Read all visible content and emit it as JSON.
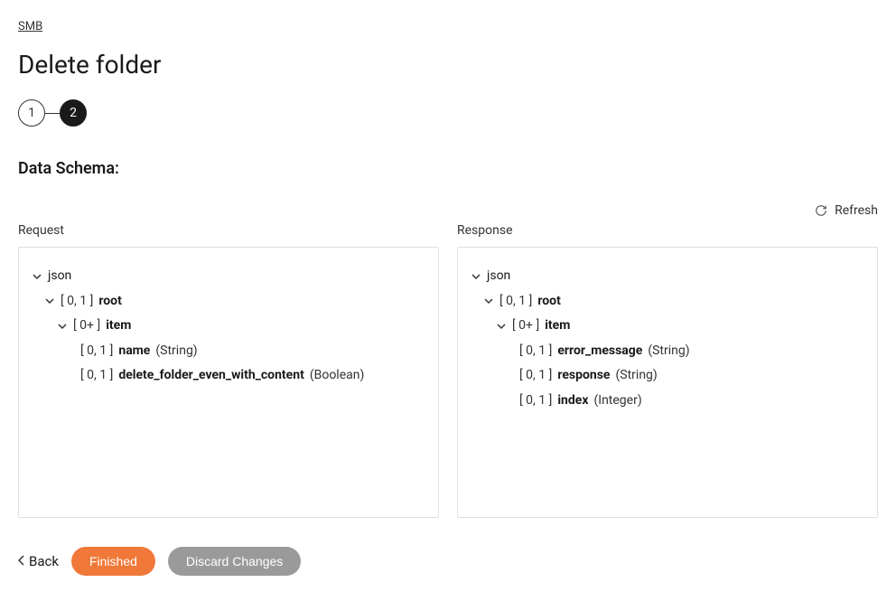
{
  "breadcrumb": "SMB",
  "page_title": "Delete folder",
  "stepper": {
    "step1": "1",
    "step2": "2"
  },
  "section_title": "Data Schema:",
  "refresh_label": "Refresh",
  "columns": {
    "request_label": "Request",
    "response_label": "Response"
  },
  "request_tree": {
    "json": "json",
    "root_card": "[ 0, 1 ]",
    "root_name": "root",
    "item_card": "[ 0+ ]",
    "item_name": "item",
    "f1_card": "[ 0, 1 ]",
    "f1_name": "name",
    "f1_type": "(String)",
    "f2_card": "[ 0, 1 ]",
    "f2_name": "delete_folder_even_with_content",
    "f2_type": "(Boolean)"
  },
  "response_tree": {
    "json": "json",
    "root_card": "[ 0, 1 ]",
    "root_name": "root",
    "item_card": "[ 0+ ]",
    "item_name": "item",
    "f1_card": "[ 0, 1 ]",
    "f1_name": "error_message",
    "f1_type": "(String)",
    "f2_card": "[ 0, 1 ]",
    "f2_name": "response",
    "f2_type": "(String)",
    "f3_card": "[ 0, 1 ]",
    "f3_name": "index",
    "f3_type": "(Integer)"
  },
  "footer": {
    "back": "Back",
    "finished": "Finished",
    "discard": "Discard Changes"
  }
}
